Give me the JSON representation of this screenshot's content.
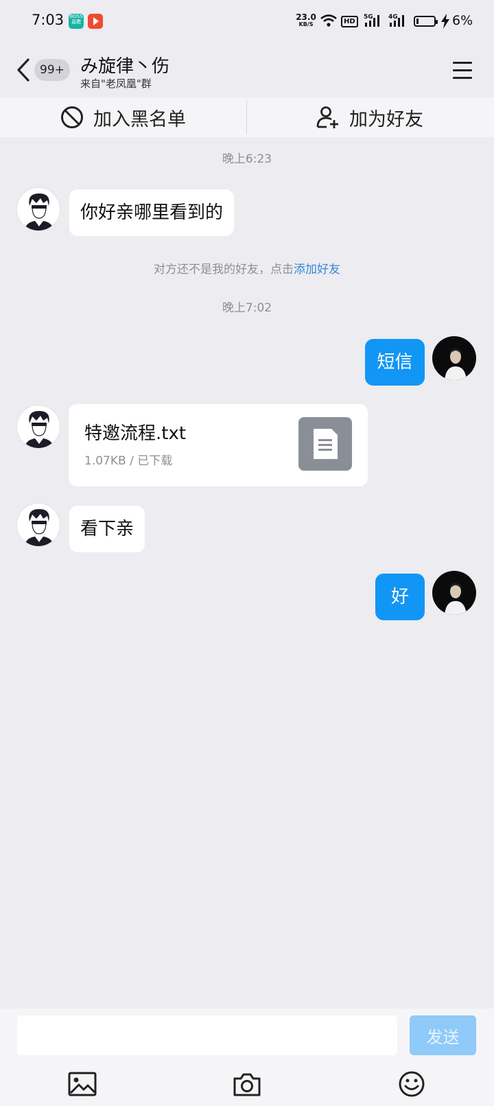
{
  "status_bar": {
    "time": "7:03",
    "app_badge_text": "BOSS\n直聘",
    "net_speed": "23.0",
    "net_unit": "KB/S",
    "hd_label": "HD",
    "signal1_label": "5G",
    "signal2_label": "4G",
    "battery_pct": "6%",
    "battery_level": 0.06
  },
  "header": {
    "unread_badge": "99+",
    "title": "み旋律丶伤",
    "subtitle": "来自\"老凤凰\"群"
  },
  "actions": {
    "blacklist_label": "加入黑名单",
    "add_friend_label": "加为好友"
  },
  "chat": {
    "timestamp1": "晚上6:23",
    "msg1": "你好亲哪里看到的",
    "system_text": "对方还不是我的好友，点击",
    "system_link": "添加好友",
    "timestamp2": "晚上7:02",
    "msg2": "短信",
    "file_name": "特邀流程.txt",
    "file_meta": "1.07KB / 已下载",
    "msg3": "看下亲",
    "msg4": "好"
  },
  "input": {
    "placeholder": "",
    "send_label": "发送"
  },
  "colors": {
    "bubble_self": "#1296f5",
    "link": "#3a86d7",
    "background": "#ececf1"
  }
}
